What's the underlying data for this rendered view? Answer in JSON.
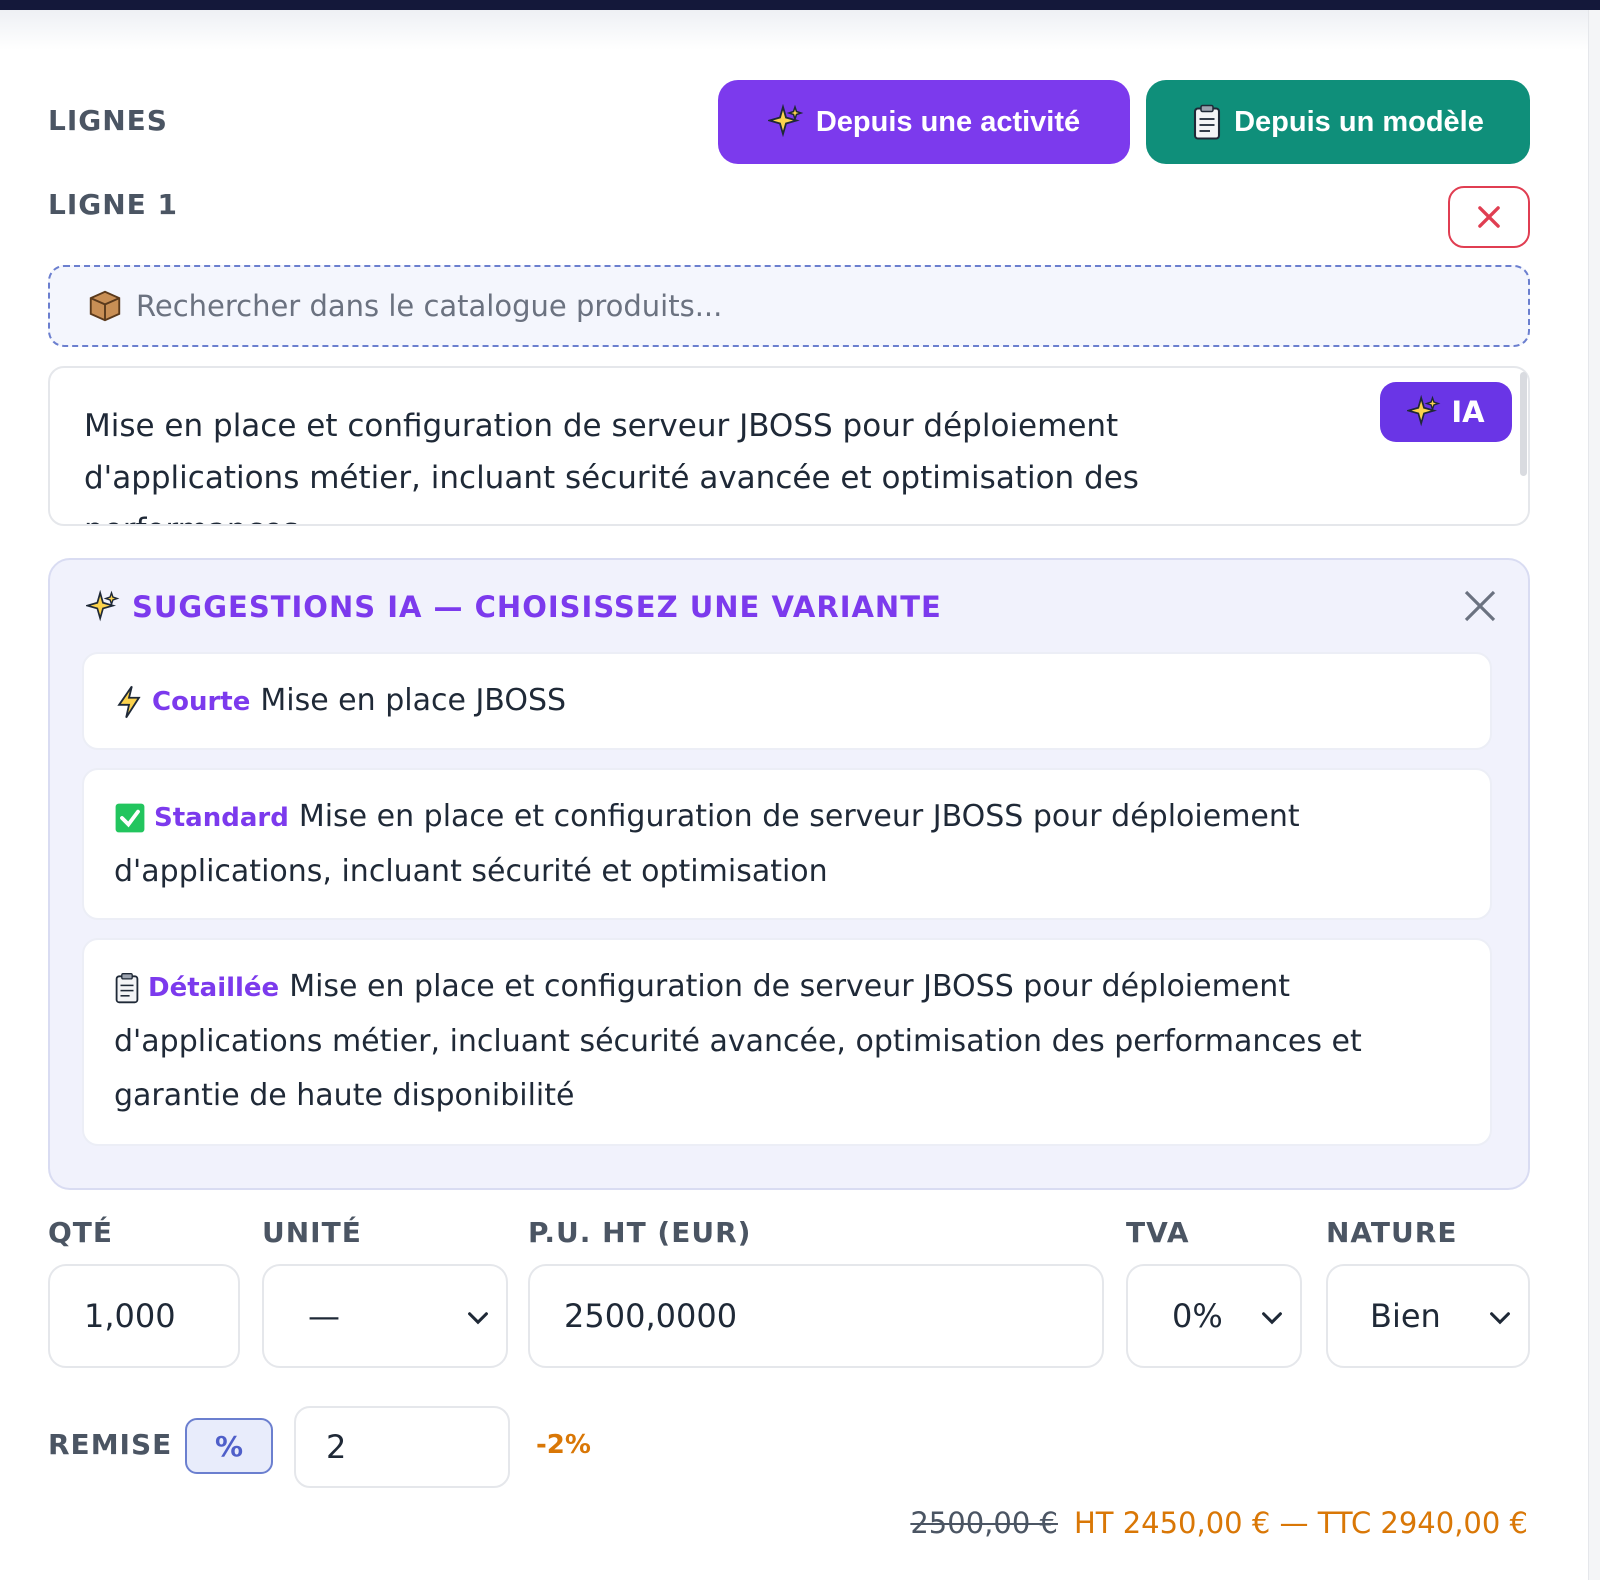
{
  "section": {
    "title": "LIGNES"
  },
  "actions": {
    "from_activity": "Depuis une activité",
    "from_template": "Depuis un modèle"
  },
  "line": {
    "title": "LIGNE 1",
    "search_placeholder": "Rechercher dans le catalogue produits...",
    "description": "Mise en place et configuration de serveur JBOSS pour déploiement d'applications métier, incluant sécurité avancée et optimisation des performances",
    "ia_button": "IA"
  },
  "suggestions": {
    "header": "SUGGESTIONS IA — CHOISISSEZ UNE VARIANTE",
    "variants": [
      {
        "tag": "Courte",
        "icon": "lightning-icon",
        "text": "Mise en place JBOSS"
      },
      {
        "tag": "Standard",
        "icon": "check-box-icon",
        "text": "Mise en place et configuration de serveur JBOSS pour déploiement d'applications, incluant sécurité et optimisation"
      },
      {
        "tag": "Détaillée",
        "icon": "clipboard-icon",
        "text": "Mise en place et configuration de serveur JBOSS pour déploiement d'applications métier, incluant sécurité avancée, optimisation des performances et garantie de haute disponibilité"
      }
    ]
  },
  "fields": {
    "qty": {
      "label": "QTÉ",
      "value": "1,000"
    },
    "unit": {
      "label": "UNITÉ",
      "value": "—"
    },
    "price": {
      "label": "P.U. HT (EUR)",
      "value": "2500,0000"
    },
    "vat": {
      "label": "TVA",
      "value": "0%"
    },
    "nature": {
      "label": "NATURE",
      "value": "Bien"
    }
  },
  "discount": {
    "label": "REMISE",
    "type": "%",
    "value": "2",
    "delta": "-2%"
  },
  "totals": {
    "original": "2500,00 €",
    "summary": "HT 2450,00 € — TTC 2940,00 €"
  },
  "colors": {
    "accent_purple": "#7c3aed",
    "accent_green": "#0f8f7a",
    "danger": "#e03e52",
    "warning": "#d97706"
  }
}
